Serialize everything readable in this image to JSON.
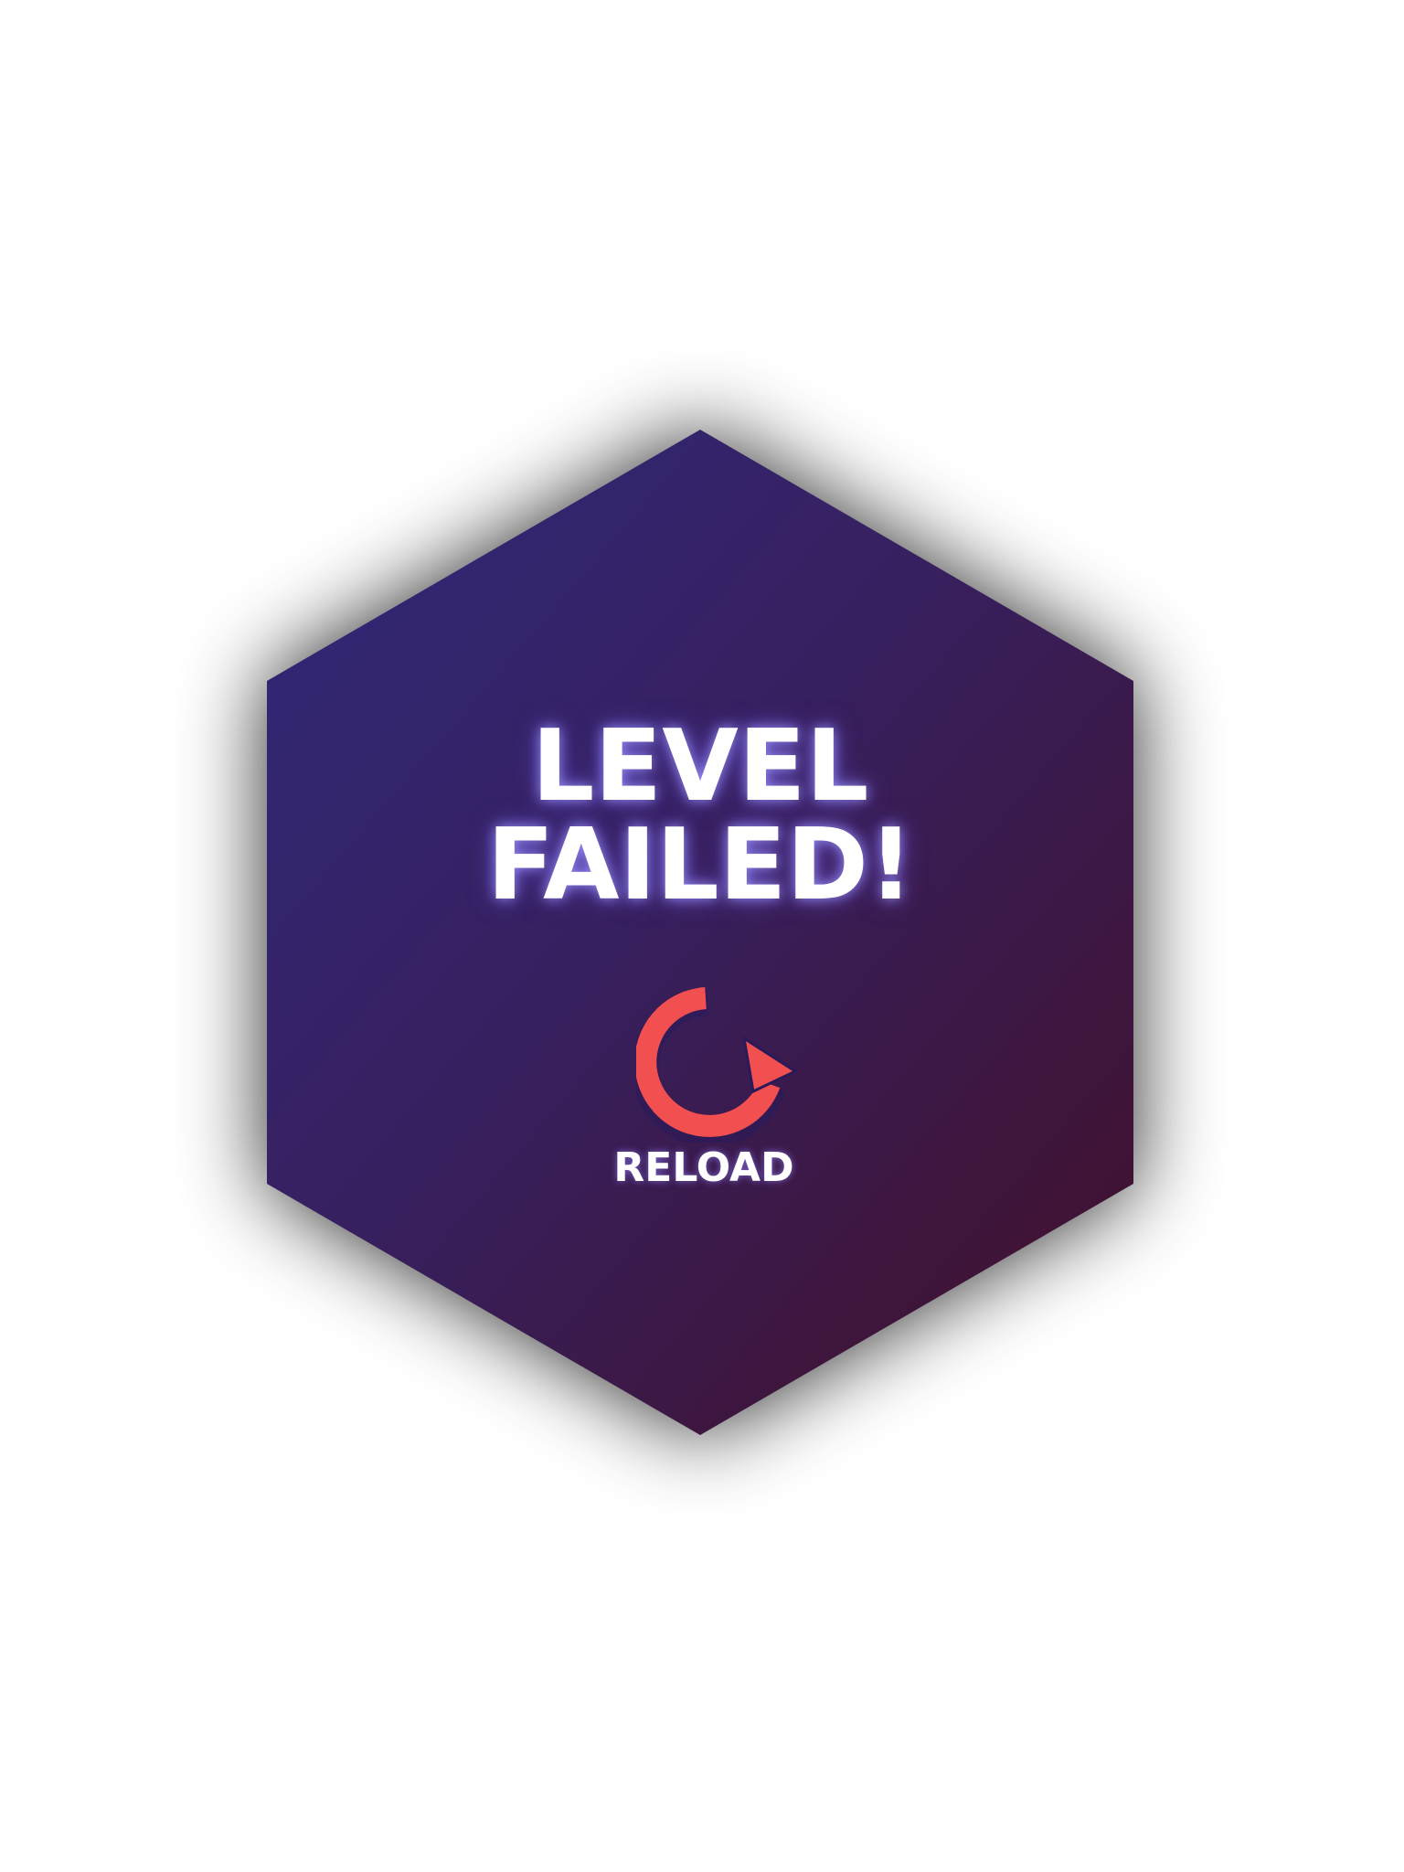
{
  "dialog": {
    "title_line_1": "LEVEL",
    "title_line_2": "FAILED!",
    "reload_label": "RELOAD",
    "reload_icon": "reload-icon"
  },
  "colors": {
    "background": "#ffffff",
    "panel_top_left": "#312470",
    "panel_bottom_right": "#40112c",
    "accent_red": "#f25050",
    "text": "#ffffff"
  }
}
